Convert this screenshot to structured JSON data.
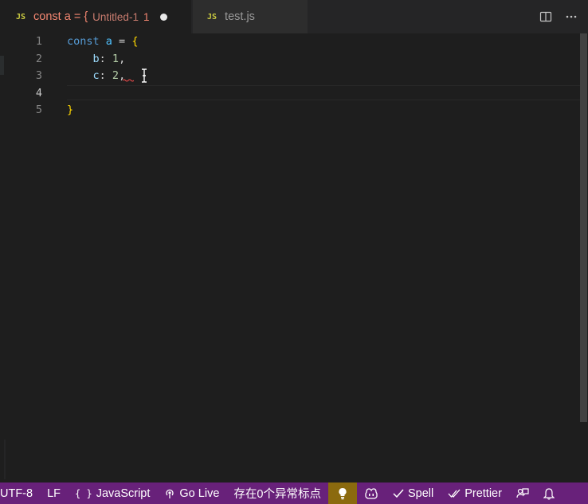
{
  "tabs": [
    {
      "icon": "JS",
      "title": "const a = {",
      "description": "Untitled-1",
      "problem_count": "1",
      "dirty": true
    },
    {
      "icon": "JS",
      "title": "test.js"
    }
  ],
  "editor": {
    "line_numbers": [
      "1",
      "2",
      "3",
      "4",
      "5"
    ],
    "current_line": "4",
    "lines": [
      [
        {
          "t": "const",
          "c": "kw"
        },
        {
          "t": " ",
          "c": ""
        },
        {
          "t": "a",
          "c": "var"
        },
        {
          "t": " = ",
          "c": ""
        },
        {
          "t": "{",
          "c": "brace"
        }
      ],
      [
        {
          "t": "    ",
          "c": ""
        },
        {
          "t": "b",
          "c": "prop"
        },
        {
          "t": ": ",
          "c": ""
        },
        {
          "t": "1",
          "c": "num"
        },
        {
          "t": ",",
          "c": ""
        }
      ],
      [
        {
          "t": "    ",
          "c": ""
        },
        {
          "t": "c",
          "c": "prop"
        },
        {
          "t": ": ",
          "c": ""
        },
        {
          "t": "2",
          "c": "num"
        },
        {
          "t": ",",
          "c": ""
        }
      ],
      [],
      [
        {
          "t": "}",
          "c": "brace"
        }
      ]
    ]
  },
  "status_bar": {
    "encoding": "UTF-8",
    "eol": "LF",
    "language_brackets": "{ }",
    "language": "JavaScript",
    "go_live": "Go Live",
    "problems": "存在0个异常标点",
    "spell": "Spell",
    "prettier": "Prettier"
  },
  "colors": {
    "accent": "#68217a",
    "lightbulb_bg": "#8b6a0e",
    "dirty_tab": "#f48771",
    "js_icon": "#cbcb41"
  }
}
